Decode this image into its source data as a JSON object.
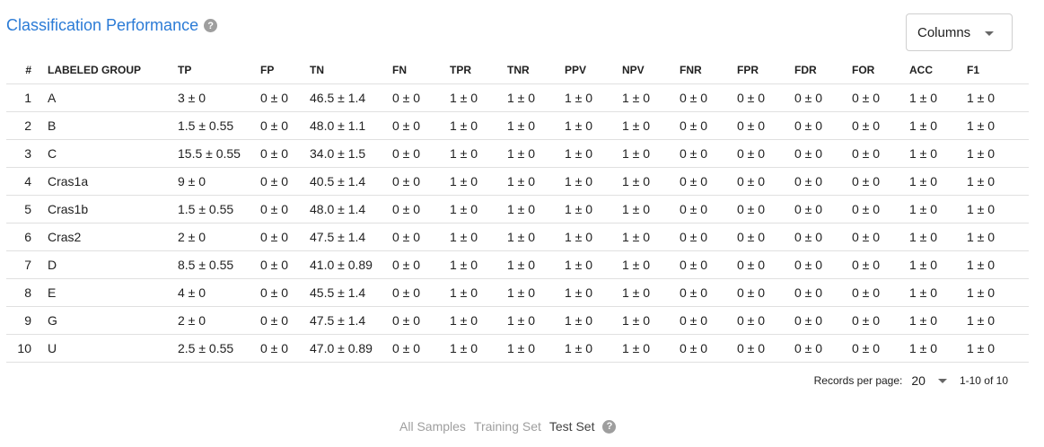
{
  "header": {
    "title": "Classification Performance",
    "help_icon": "?"
  },
  "columns_button": {
    "label": "Columns"
  },
  "table": {
    "headers": [
      "#",
      "LABELED GROUP",
      "TP",
      "FP",
      "TN",
      "FN",
      "TPR",
      "TNR",
      "PPV",
      "NPV",
      "FNR",
      "FPR",
      "FDR",
      "FOR",
      "ACC",
      "F1"
    ],
    "rows": [
      [
        "1",
        "A",
        "3 ± 0",
        "0 ± 0",
        "46.5 ± 1.4",
        "0 ± 0",
        "1 ± 0",
        "1 ± 0",
        "1 ± 0",
        "1 ± 0",
        "0 ± 0",
        "0 ± 0",
        "0 ± 0",
        "0 ± 0",
        "1 ± 0",
        "1 ± 0"
      ],
      [
        "2",
        "B",
        "1.5 ± 0.55",
        "0 ± 0",
        "48.0 ± 1.1",
        "0 ± 0",
        "1 ± 0",
        "1 ± 0",
        "1 ± 0",
        "1 ± 0",
        "0 ± 0",
        "0 ± 0",
        "0 ± 0",
        "0 ± 0",
        "1 ± 0",
        "1 ± 0"
      ],
      [
        "3",
        "C",
        "15.5 ± 0.55",
        "0 ± 0",
        "34.0 ± 1.5",
        "0 ± 0",
        "1 ± 0",
        "1 ± 0",
        "1 ± 0",
        "1 ± 0",
        "0 ± 0",
        "0 ± 0",
        "0 ± 0",
        "0 ± 0",
        "1 ± 0",
        "1 ± 0"
      ],
      [
        "4",
        "Cras1a",
        "9 ± 0",
        "0 ± 0",
        "40.5 ± 1.4",
        "0 ± 0",
        "1 ± 0",
        "1 ± 0",
        "1 ± 0",
        "1 ± 0",
        "0 ± 0",
        "0 ± 0",
        "0 ± 0",
        "0 ± 0",
        "1 ± 0",
        "1 ± 0"
      ],
      [
        "5",
        "Cras1b",
        "1.5 ± 0.55",
        "0 ± 0",
        "48.0 ± 1.4",
        "0 ± 0",
        "1 ± 0",
        "1 ± 0",
        "1 ± 0",
        "1 ± 0",
        "0 ± 0",
        "0 ± 0",
        "0 ± 0",
        "0 ± 0",
        "1 ± 0",
        "1 ± 0"
      ],
      [
        "6",
        "Cras2",
        "2 ± 0",
        "0 ± 0",
        "47.5 ± 1.4",
        "0 ± 0",
        "1 ± 0",
        "1 ± 0",
        "1 ± 0",
        "1 ± 0",
        "0 ± 0",
        "0 ± 0",
        "0 ± 0",
        "0 ± 0",
        "1 ± 0",
        "1 ± 0"
      ],
      [
        "7",
        "D",
        "8.5 ± 0.55",
        "0 ± 0",
        "41.0 ± 0.89",
        "0 ± 0",
        "1 ± 0",
        "1 ± 0",
        "1 ± 0",
        "1 ± 0",
        "0 ± 0",
        "0 ± 0",
        "0 ± 0",
        "0 ± 0",
        "1 ± 0",
        "1 ± 0"
      ],
      [
        "8",
        "E",
        "4 ± 0",
        "0 ± 0",
        "45.5 ± 1.4",
        "0 ± 0",
        "1 ± 0",
        "1 ± 0",
        "1 ± 0",
        "1 ± 0",
        "0 ± 0",
        "0 ± 0",
        "0 ± 0",
        "0 ± 0",
        "1 ± 0",
        "1 ± 0"
      ],
      [
        "9",
        "G",
        "2 ± 0",
        "0 ± 0",
        "47.5 ± 1.4",
        "0 ± 0",
        "1 ± 0",
        "1 ± 0",
        "1 ± 0",
        "1 ± 0",
        "0 ± 0",
        "0 ± 0",
        "0 ± 0",
        "0 ± 0",
        "1 ± 0",
        "1 ± 0"
      ],
      [
        "10",
        "U",
        "2.5 ± 0.55",
        "0 ± 0",
        "47.0 ± 0.89",
        "0 ± 0",
        "1 ± 0",
        "1 ± 0",
        "1 ± 0",
        "1 ± 0",
        "0 ± 0",
        "0 ± 0",
        "0 ± 0",
        "0 ± 0",
        "1 ± 0",
        "1 ± 0"
      ]
    ]
  },
  "pagination": {
    "label": "Records per page:",
    "per_page": "20",
    "range": "1-10 of 10"
  },
  "set_tabs": {
    "items": [
      "All Samples",
      "Training Set",
      "Test Set"
    ],
    "active": "Test Set"
  }
}
